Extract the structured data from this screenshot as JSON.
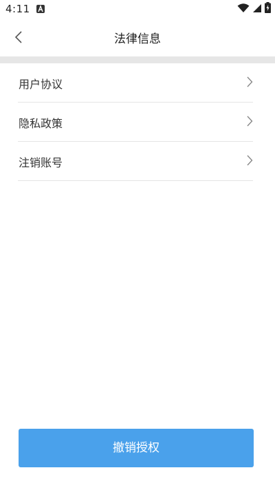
{
  "status_bar": {
    "time": "4:11",
    "icons": [
      "notification-a-icon",
      "wifi-icon",
      "cellular-signal-icon",
      "battery-charging-icon"
    ]
  },
  "header": {
    "title": "法律信息",
    "back_icon": "chevron-left-icon"
  },
  "menu": {
    "items": [
      {
        "label": "用户协议",
        "icon": "chevron-right-icon"
      },
      {
        "label": "隐私政策",
        "icon": "chevron-right-icon"
      },
      {
        "label": "注销账号",
        "icon": "chevron-right-icon"
      }
    ]
  },
  "footer": {
    "revoke_label": "撤销授权"
  },
  "colors": {
    "accent": "#4aa1eb",
    "divider": "#e4e4e4",
    "band": "#e6e6e6"
  }
}
